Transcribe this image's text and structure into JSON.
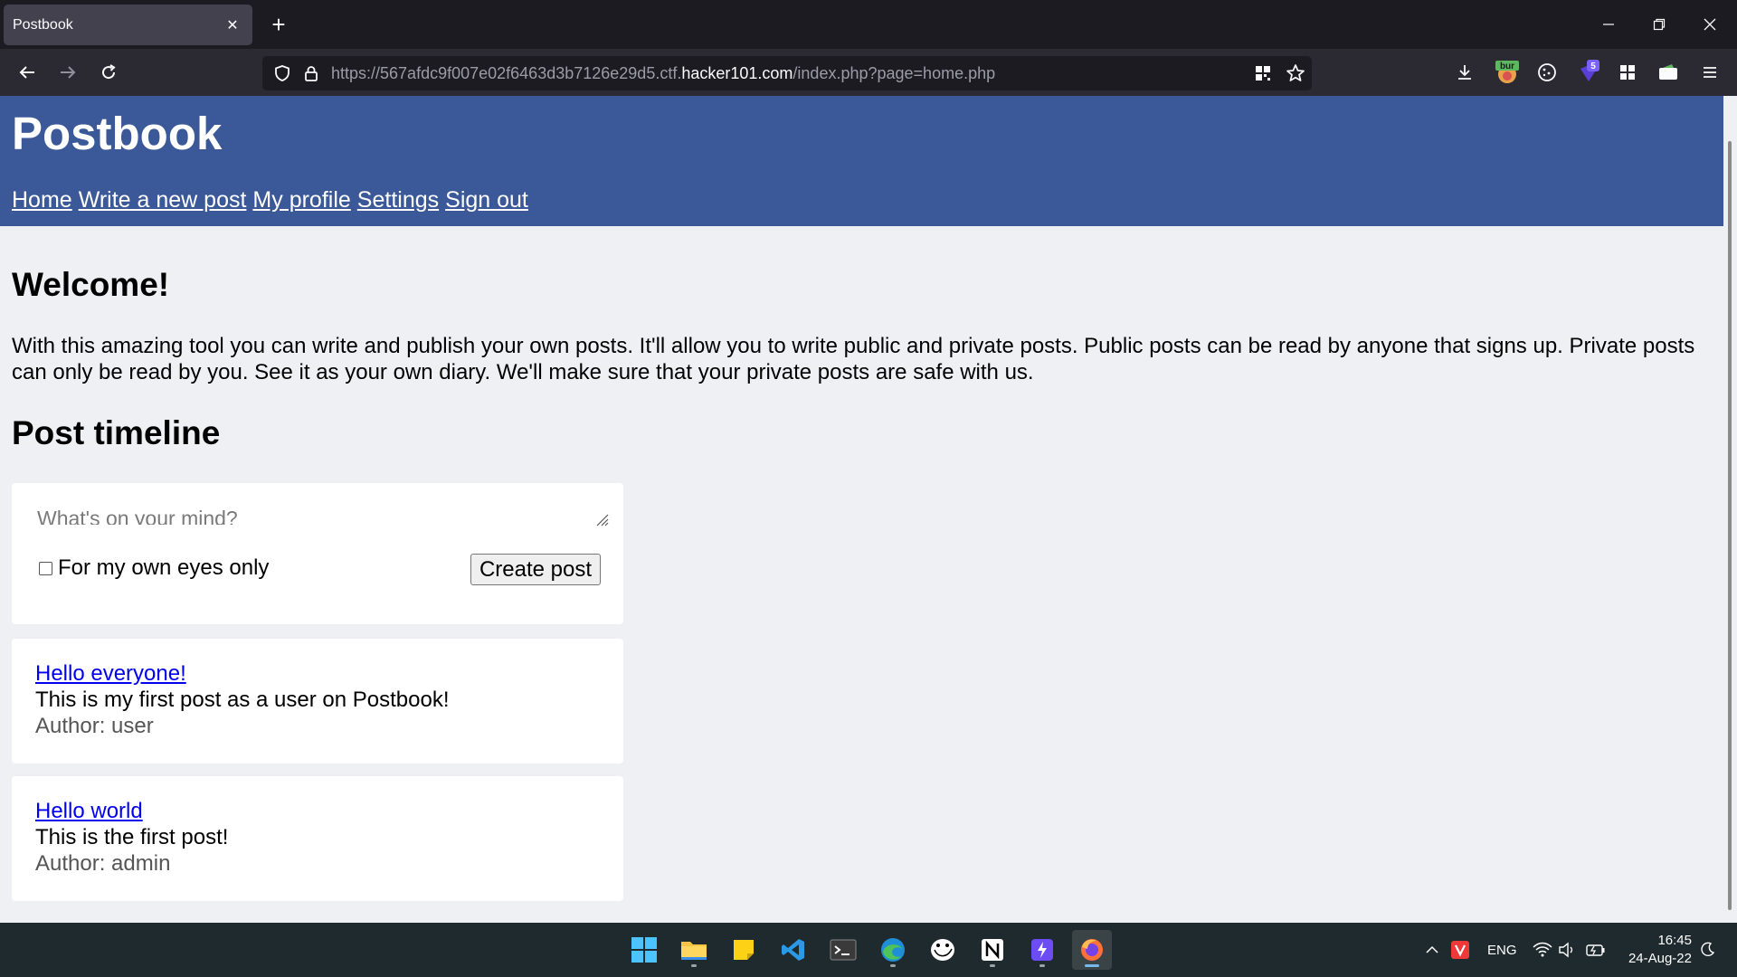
{
  "browser": {
    "tab_title": "Postbook",
    "tab_close": "✕",
    "new_tab": "+",
    "url_prefix": "https://567afdc9f007e02f6463d3b7126e29d5.ctf.",
    "url_host": "hacker101.com",
    "url_path": "/index.php?page=home.php",
    "extension_badge": "5",
    "burp_label": "bur"
  },
  "site": {
    "title": "Postbook",
    "nav": [
      "Home",
      "Write a new post",
      "My profile",
      "Settings",
      "Sign out"
    ]
  },
  "main": {
    "welcome_heading": "Welcome!",
    "intro": "With this amazing tool you can write and publish your own posts. It'll allow you to write public and private posts. Public posts can be read by anyone that signs up. Private posts can only be read by you. See it as your own diary. We'll make sure that your private posts are safe with us.",
    "timeline_heading": "Post timeline"
  },
  "composer": {
    "placeholder": "What's on your mind?",
    "private_label": "For my own eyes only",
    "private_checked": false,
    "submit_label": "Create post"
  },
  "posts": [
    {
      "title": "Hello everyone!",
      "body": "This is my first post as a user on Postbook!",
      "author": "Author: user"
    },
    {
      "title": "Hello world",
      "body": "This is the first post!",
      "author": "Author: admin"
    }
  ],
  "taskbar": {
    "language": "ENG",
    "time": "16:45",
    "date": "24-Aug-22"
  },
  "colors": {
    "header_bg": "#3b5998",
    "page_bg": "#eef0f4",
    "link": "#0000ee"
  }
}
